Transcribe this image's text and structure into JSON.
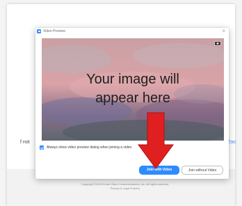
{
  "background": {
    "left_text": "f not",
    "right_text": "Zoo",
    "copyright_line1": "Copyright ©2020 Zoom Video Communications, Inc. All rights reserved.",
    "copyright_line2": "Privacy & Legal Policies"
  },
  "dialog": {
    "title": "Video Preview",
    "close_glyph": "×",
    "preview_text_line1": "Your image will",
    "preview_text_line2": "appear here",
    "checkbox_label": "Always show video preview dialog when joining a video",
    "checkbox_checked": true,
    "join_with_video_label": "Join with Video",
    "join_without_video_label": "Join without Video"
  },
  "colors": {
    "accent": "#2d8cff",
    "annotation_arrow": "#e02020"
  },
  "icons": {
    "app": "zoom-camera-icon",
    "close": "close-icon",
    "camera": "camera-icon",
    "annotation": "down-arrow-icon"
  }
}
